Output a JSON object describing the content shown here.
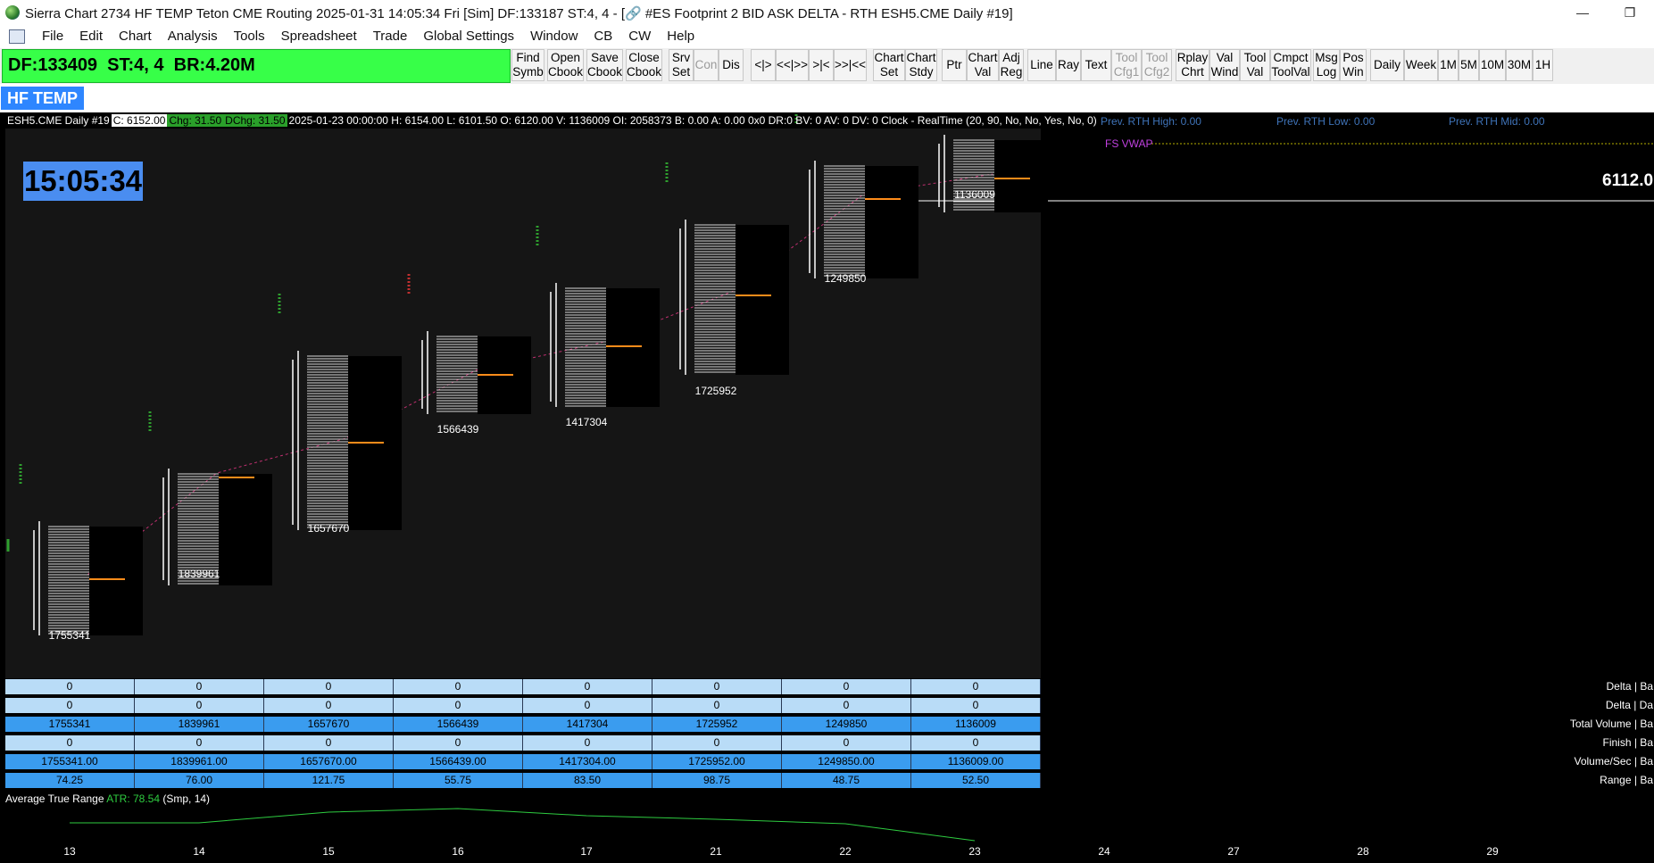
{
  "window": {
    "title": "Sierra Chart 2734 HF TEMP Teton CME Routing 2025-01-31  14:05:34 Fri [Sim] DF:133187  ST:4, 4 - [🔗 #ES Footprint 2 BID ASK DELTA - RTH ESH5.CME  Daily #19]",
    "minimize": "—",
    "restore": "❐"
  },
  "menu": [
    "File",
    "Edit",
    "Chart",
    "Analysis",
    "Tools",
    "Spreadsheet",
    "Trade",
    "Global Settings",
    "Window",
    "CB",
    "CW",
    "Help"
  ],
  "status_panel": "DF:133409  ST:4, 4  BR:4.20M",
  "toolbar": [
    {
      "label": "Find\nSymb"
    },
    {
      "label": "Open\nCbook"
    },
    {
      "label": "Save\nCbook"
    },
    {
      "label": "Close\nCbook"
    },
    {
      "label": "Srv\nSet"
    },
    {
      "label": "Con",
      "disabled": true
    },
    {
      "label": "Dis"
    },
    {
      "label": "<|>"
    },
    {
      "label": "<<|>>"
    },
    {
      "label": ">|<"
    },
    {
      "label": ">>|<<"
    },
    {
      "label": "Chart\nSet"
    },
    {
      "label": "Chart\nStdy"
    },
    {
      "label": "Ptr"
    },
    {
      "label": "Chart\nVal"
    },
    {
      "label": "Adj\nReg"
    },
    {
      "label": "Line"
    },
    {
      "label": "Ray"
    },
    {
      "label": "Text"
    },
    {
      "label": "Tool\nCfg1",
      "disabled": true
    },
    {
      "label": "Tool\nCfg2",
      "disabled": true
    },
    {
      "label": "Rplay\nChrt"
    },
    {
      "label": "Val\nWind"
    },
    {
      "label": "Tool\nVal"
    },
    {
      "label": "Cmpct\nToolVal"
    },
    {
      "label": "Msg\nLog"
    },
    {
      "label": "Pos\nWin"
    },
    {
      "label": "Daily"
    },
    {
      "label": "Week"
    },
    {
      "label": "1M"
    },
    {
      "label": "5M"
    },
    {
      "label": "10M"
    },
    {
      "label": "30M"
    },
    {
      "label": "1H"
    }
  ],
  "chartbook_tab": "HF TEMP",
  "info_line": {
    "symbol": "ESH5.CME  Daily #19",
    "c": "C: 6152.00",
    "chg": "Chg: 31.50",
    "dchg": "DChg: 31.50",
    "rest": "2025-01-23 00:00:00 H: 6154.00 L: 6101.50 O: 6120.00 V: 1136009 OI: 2058373 B: 0.00 A: 0.00 0x0 DR:0 BV: 0 AV: 0 DV: 0 Clock - RealTime  (20, 90, No, No, Yes, No, 0)"
  },
  "prev_labels": {
    "high": "Prev. RTH High: 0.00",
    "low": "Prev. RTH Low: 0.00",
    "mid": "Prev. RTH Mid: 0.00"
  },
  "clock": "15:05:34",
  "vwap_label": "FS VWAP",
  "price_label": "6112.0",
  "bar_volumes": [
    "1755341",
    "1839961",
    "1657670",
    "1566439",
    "1417304",
    "1725952",
    "1249850",
    "1136009"
  ],
  "stats": {
    "rows": [
      {
        "label": "Delta | Ba",
        "values": [
          "0",
          "0",
          "0",
          "0",
          "0",
          "0",
          "0",
          "0"
        ],
        "color": "#b9dcf7"
      },
      {
        "label": "Delta | Da",
        "values": [
          "0",
          "0",
          "0",
          "0",
          "0",
          "0",
          "0",
          "0"
        ],
        "color": "#b9dcf7"
      },
      {
        "label": "Total Volume | Ba",
        "values": [
          "1755341",
          "1839961",
          "1657670",
          "1566439",
          "1417304",
          "1725952",
          "1249850",
          "1136009"
        ],
        "color": "#3a9cef"
      },
      {
        "label": "Finish | Ba",
        "values": [
          "0",
          "0",
          "0",
          "0",
          "0",
          "0",
          "0",
          "0"
        ],
        "color": "#b9dcf7"
      },
      {
        "label": "Volume/Sec | Ba",
        "values": [
          "1755341.00",
          "1839961.00",
          "1657670.00",
          "1566439.00",
          "1417304.00",
          "1725952.00",
          "1249850.00",
          "1136009.00"
        ],
        "color": "#3a9cef"
      },
      {
        "label": "Range | Ba",
        "values": [
          "74.25",
          "76.00",
          "121.75",
          "55.75",
          "83.50",
          "98.75",
          "48.75",
          "52.50"
        ],
        "color": "#3a9cef"
      }
    ]
  },
  "atr": {
    "title": "Average True Range",
    "value": "ATR: 78.54",
    "params": "(Smp, 14)"
  },
  "x_axis": [
    "13",
    "14",
    "15",
    "16",
    "17",
    "21",
    "22",
    "23",
    "24",
    "27",
    "28",
    "29"
  ],
  "colors": {
    "status_green": "#37ff48",
    "hf_tab_blue": "#2e86ff",
    "clock_blue": "#4a8df0",
    "poc_orange": "#ff8c1a",
    "vwap_magenta": "#c040e0",
    "atr_green": "#2ecc40"
  }
}
